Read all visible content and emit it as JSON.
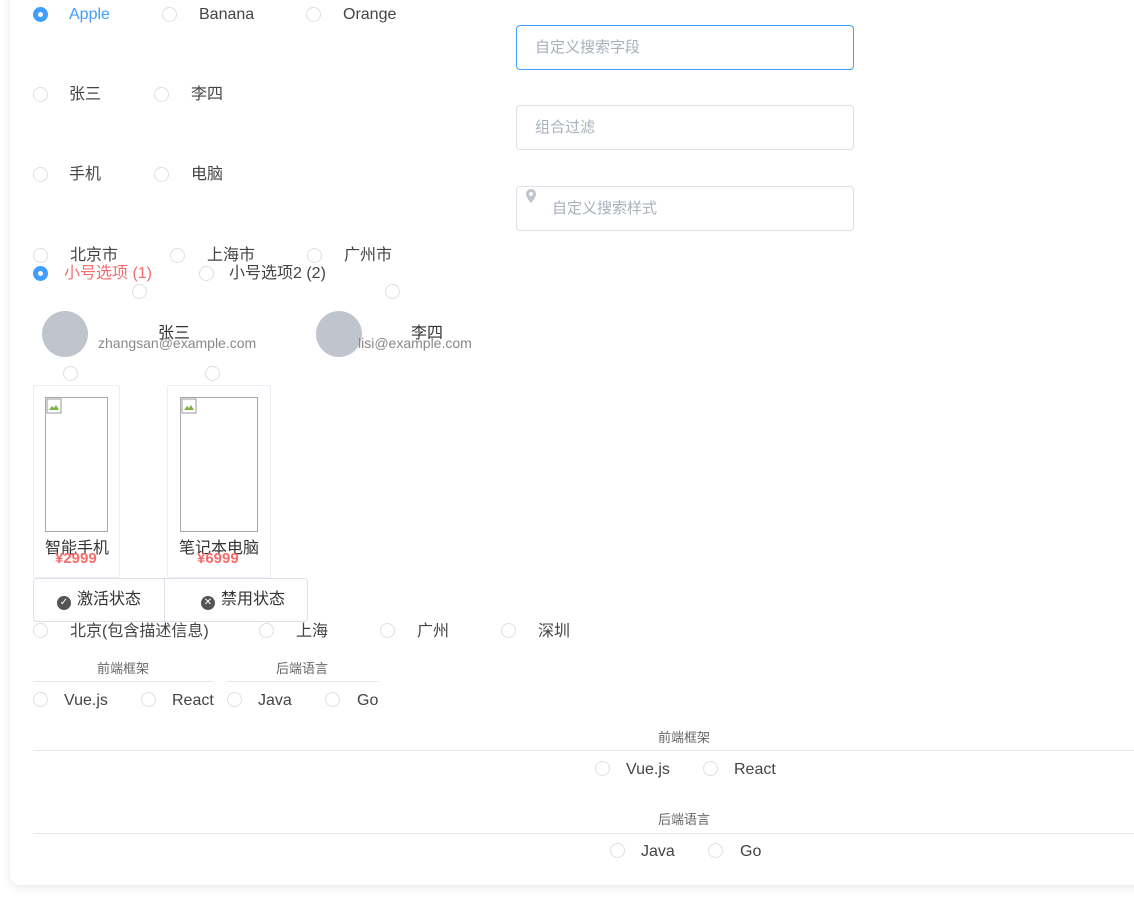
{
  "fruit_radios": [
    {
      "label": "Apple",
      "checked": true
    },
    {
      "label": "Banana",
      "checked": false
    },
    {
      "label": "Orange",
      "checked": false
    }
  ],
  "people_radios": [
    {
      "label": "张三",
      "checked": false
    },
    {
      "label": "李四",
      "checked": false
    }
  ],
  "device_radios": [
    {
      "label": "手机",
      "checked": false
    },
    {
      "label": "电脑",
      "checked": false
    }
  ],
  "city_radios": [
    {
      "label": "北京市",
      "checked": false
    },
    {
      "label": "上海市",
      "checked": false
    },
    {
      "label": "广州市",
      "checked": false
    }
  ],
  "small_radios": [
    {
      "label": "小号选项 (1)",
      "checked": true
    },
    {
      "label": "小号选项2 (2)",
      "checked": false
    }
  ],
  "inputs": {
    "custom_search_field": {
      "placeholder": "自定义搜索字段",
      "value": ""
    },
    "combo_filter": {
      "placeholder": "组合过滤",
      "value": ""
    },
    "custom_search_style": {
      "placeholder": "自定义搜索样式",
      "value": "",
      "icon": "location-pin-icon"
    }
  },
  "user_cards": [
    {
      "name": "张三",
      "email": "zhangsan@example.com"
    },
    {
      "name": "李四",
      "email": "lisi@example.com"
    }
  ],
  "product_cards": [
    {
      "name": "智能手机",
      "price": "¥2999"
    },
    {
      "name": "笔记本电脑",
      "price": "¥6999"
    }
  ],
  "status_buttons": {
    "active": {
      "label": "激活状态",
      "icon": "check-circle-icon"
    },
    "disabled": {
      "label": "禁用状态",
      "icon": "x-circle-icon"
    }
  },
  "city_desc_radios": [
    {
      "label": "北京(包含描述信息)",
      "checked": false
    },
    {
      "label": "上海",
      "checked": false
    },
    {
      "label": "广州",
      "checked": false
    },
    {
      "label": "深圳",
      "checked": false
    }
  ],
  "inline_groups": [
    {
      "title": "前端框架",
      "options": [
        "Vue.js",
        "React"
      ]
    },
    {
      "title": "后端语言",
      "options": [
        "Java",
        "Go"
      ]
    }
  ],
  "block_groups": [
    {
      "title": "前端框架",
      "options": [
        "Vue.js",
        "React"
      ]
    },
    {
      "title": "后端语言",
      "options": [
        "Java",
        "Go"
      ]
    }
  ],
  "colors": {
    "primary": "#409eff",
    "danger": "#f56c6c",
    "border": "#dcdfe6"
  }
}
